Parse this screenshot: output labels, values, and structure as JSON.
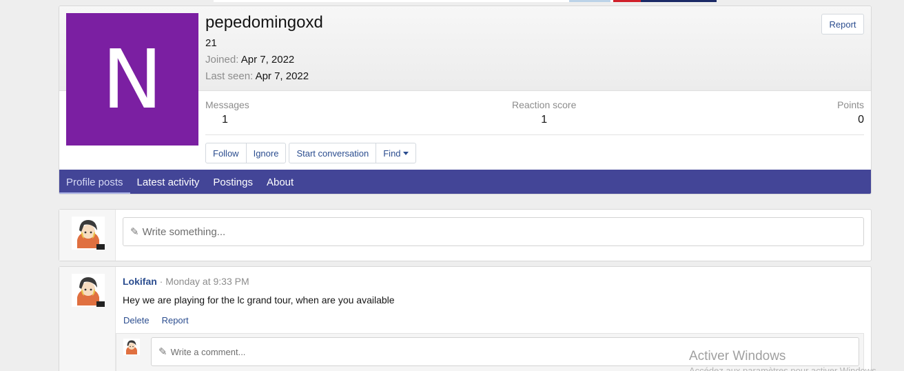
{
  "profile": {
    "avatar_letter": "N",
    "avatar_color": "#7b1fa2",
    "username": "pepedomingoxd",
    "user_title": "21",
    "joined_label": "Joined:",
    "joined_value": "Apr 7, 2022",
    "last_seen_label": "Last seen:",
    "last_seen_value": "Apr 7, 2022",
    "report_label": "Report"
  },
  "stats": {
    "messages_label": "Messages",
    "messages_value": "1",
    "reaction_label": "Reaction score",
    "reaction_value": "1",
    "points_label": "Points",
    "points_value": "0"
  },
  "actions": {
    "follow": "Follow",
    "ignore": "Ignore",
    "start_conversation": "Start conversation",
    "find": "Find"
  },
  "tabs": [
    {
      "label": "Profile posts",
      "active": true
    },
    {
      "label": "Latest activity",
      "active": false
    },
    {
      "label": "Postings",
      "active": false
    },
    {
      "label": "About",
      "active": false
    }
  ],
  "new_post": {
    "placeholder": "Write something..."
  },
  "post": {
    "author": "Lokifan",
    "separator": "·",
    "time": "Monday at 9:33 PM",
    "body": "Hey we are playing for the lc grand tour, when are you available",
    "delete_label": "Delete",
    "report_label": "Report",
    "comment_placeholder": "Write a comment..."
  },
  "watermark": {
    "title": "Activer Windows",
    "subtitle": "Accédez aux paramètres pour activer Windows."
  },
  "colors": {
    "nav_bar": "#434597",
    "link": "#2b4d8f"
  }
}
